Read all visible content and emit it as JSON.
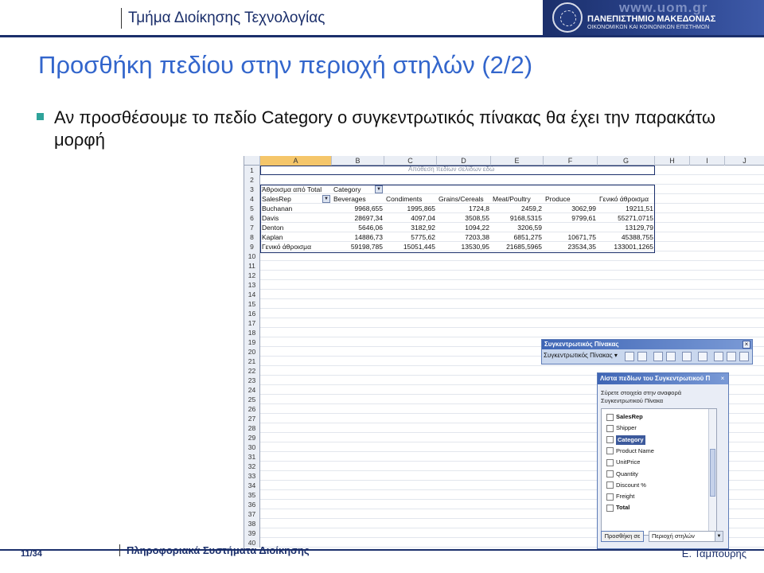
{
  "header": {
    "department": "Τμήμα Διοίκησης Τεχνολογίας",
    "university_url": "www.uom.gr",
    "university_name": "ΠΑΝΕΠΙΣΤΗΜΙΟ ΜΑΚΕΔΟΝΙΑΣ",
    "university_subtitle": "ΟΙΚΟΝΟΜΙΚΩΝ ΚΑΙ ΚΟΙΝΩΝΙΚΩΝ ΕΠΙΣΤΗΜΩΝ"
  },
  "slide": {
    "title": "Προσθήκη πεδίου στην περιοχή στηλών (2/2)",
    "bullet": "Αν προσθέσουμε το πεδίο Category ο συγκεντρωτικός πίνακας θα έχει την παρακάτω μορφή"
  },
  "sheet": {
    "columns": [
      "A",
      "B",
      "C",
      "D",
      "E",
      "F",
      "G",
      "H",
      "I",
      "J"
    ],
    "drop_hint": "Απόθεση πεδίων σελίδων εδώ",
    "pivot": {
      "data_label": "Άθροισμα από Total",
      "col_field": "Category",
      "row_field": "SalesRep",
      "headers": [
        "Beverages",
        "Condiments",
        "Grains/Cereals",
        "Meat/Poultry",
        "Produce",
        "Γενικό άθροισμα"
      ],
      "rows": [
        {
          "name": "Buchanan",
          "values": [
            "9968,655",
            "1995,865",
            "1724,8",
            "2459,2",
            "3062,99",
            "19211,51"
          ]
        },
        {
          "name": "Davis",
          "values": [
            "28697,34",
            "4097,04",
            "3508,55",
            "9168,5315",
            "9799,61",
            "55271,0715"
          ]
        },
        {
          "name": "Denton",
          "values": [
            "5646,06",
            "3182,92",
            "1094,22",
            "3206,59",
            "",
            "13129,79"
          ]
        },
        {
          "name": "Kaplan",
          "values": [
            "14886,73",
            "5775,62",
            "7203,38",
            "6851,275",
            "10671,75",
            "45388,755"
          ]
        },
        {
          "name": "Γενικό άθροισμα",
          "values": [
            "59198,785",
            "15051,445",
            "13530,95",
            "21685,5965",
            "23534,35",
            "133001,1265"
          ]
        }
      ]
    }
  },
  "toolbar": {
    "title": "Συγκεντρωτικός Πίνακας",
    "menu": "Συγκεντρωτικός Πίνακας ▾",
    "close": "×"
  },
  "fieldlist": {
    "title": "Λίστα πεδίων του Συγκεντρωτικού Π",
    "instructions": "Σύρετε στοιχεία στην αναφορά Συγκεντρωτικού Πίνακα",
    "items": [
      {
        "label": "SalesRep",
        "bold": true,
        "selected": false
      },
      {
        "label": "Shipper",
        "bold": false,
        "selected": false
      },
      {
        "label": "Category",
        "bold": true,
        "selected": true
      },
      {
        "label": "Product Name",
        "bold": false,
        "selected": false
      },
      {
        "label": "UnitPrice",
        "bold": false,
        "selected": false
      },
      {
        "label": "Quantity",
        "bold": false,
        "selected": false
      },
      {
        "label": "Discount %",
        "bold": false,
        "selected": false
      },
      {
        "label": "Freight",
        "bold": false,
        "selected": false
      },
      {
        "label": "Total",
        "bold": true,
        "selected": false
      }
    ],
    "add_button": "Προσθήκη σε",
    "area_select": "Περιοχή στηλών"
  },
  "footer": {
    "page": "11/34",
    "course": "Πληροφοριακά Συστήματα Διοίκησης",
    "author": "Ε. Ταμπουρής"
  }
}
